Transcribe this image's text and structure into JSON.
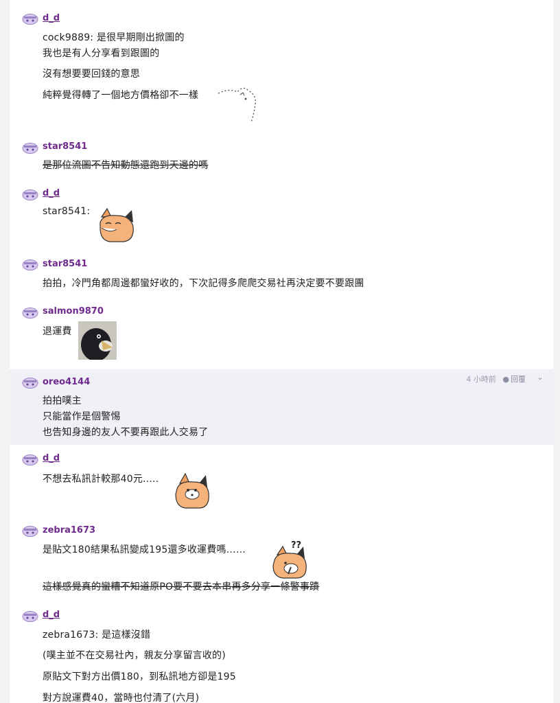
{
  "comments": [
    {
      "user": "d_d",
      "lines": [
        "cock9889: 是很早期剛出掀圖的",
        "我也是有人分享看到跟圖的",
        "沒有想要要回錢的意思",
        "純粹覺得轉了一個地方價格卻不一樣"
      ]
    },
    {
      "user": "star8541",
      "lines": [
        "是那位流圖不告知動態還跑到天邊的嗎"
      ]
    },
    {
      "user": "d_d",
      "lines": [
        "star8541:"
      ]
    },
    {
      "user": "star8541",
      "lines": [
        "拍拍，冷門角都周邊都蠻好收的，下次記得多爬爬交易社再決定要不要跟團"
      ]
    },
    {
      "user": "salmon9870",
      "lines": [
        "退運費"
      ]
    },
    {
      "user": "oreo4144",
      "time": "4 小時前",
      "reply": "回覆",
      "lines": [
        "拍拍噗主",
        "只能當作是個警惕",
        "也告知身邊的友人不要再跟此人交易了"
      ]
    },
    {
      "user": "d_d",
      "lines": [
        "不想去私訊計較那40元....."
      ]
    },
    {
      "user": "zebra1673",
      "lines": [
        "是貼文180結果私訊變成195還多收運費嗎……",
        "這樣感覺真的蠻糟不知道原PO要不要去本串再多分享一條警事蹟"
      ]
    },
    {
      "user": "d_d",
      "lines": [
        "zebra1673: 是這樣沒錯",
        "(噗主並不在交易社內，親友分享留言收的)",
        "原貼文下對方出價180，到私訊地方卻是195",
        "對方說運費40，當時也付清了(六月)"
      ]
    }
  ],
  "icons": {
    "avatar": "plurk-avatar-icon",
    "reply": "speech-bubble-icon",
    "menu": "chevron-down-icon"
  },
  "colors": {
    "username": "#6e2a8c",
    "highlight_bg": "#f0f0f7",
    "avatar": "#b9a3d8"
  }
}
